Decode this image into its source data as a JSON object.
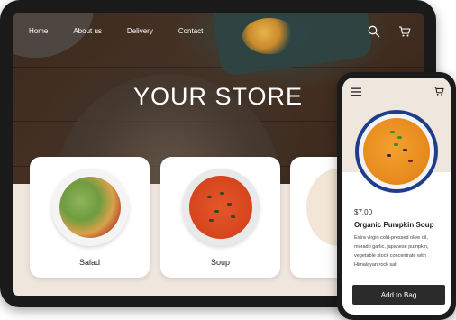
{
  "nav": {
    "items": [
      "Home",
      "About us",
      "Delivery",
      "Contact"
    ],
    "search_icon": "search-icon",
    "cart_icon": "cart-icon"
  },
  "hero": {
    "title": "YOUR STORE"
  },
  "products": [
    {
      "label": "Salad"
    },
    {
      "label": "Soup"
    }
  ],
  "phone": {
    "menu_icon": "hamburger-menu-icon",
    "cart_icon": "cart-icon",
    "price": "$7.00",
    "name": "Organic Pumpkin Soup",
    "description": "Extra virgin cold-pressed olive oil, morado garlic, japanese pumpkin, vegetable stock concentrate with Himalayan rock salt",
    "add_button": "Add to Bag"
  },
  "colors": {
    "accent_dark": "#2b2b2b",
    "background_band": "#efe6de",
    "text_white": "#ffffff"
  }
}
